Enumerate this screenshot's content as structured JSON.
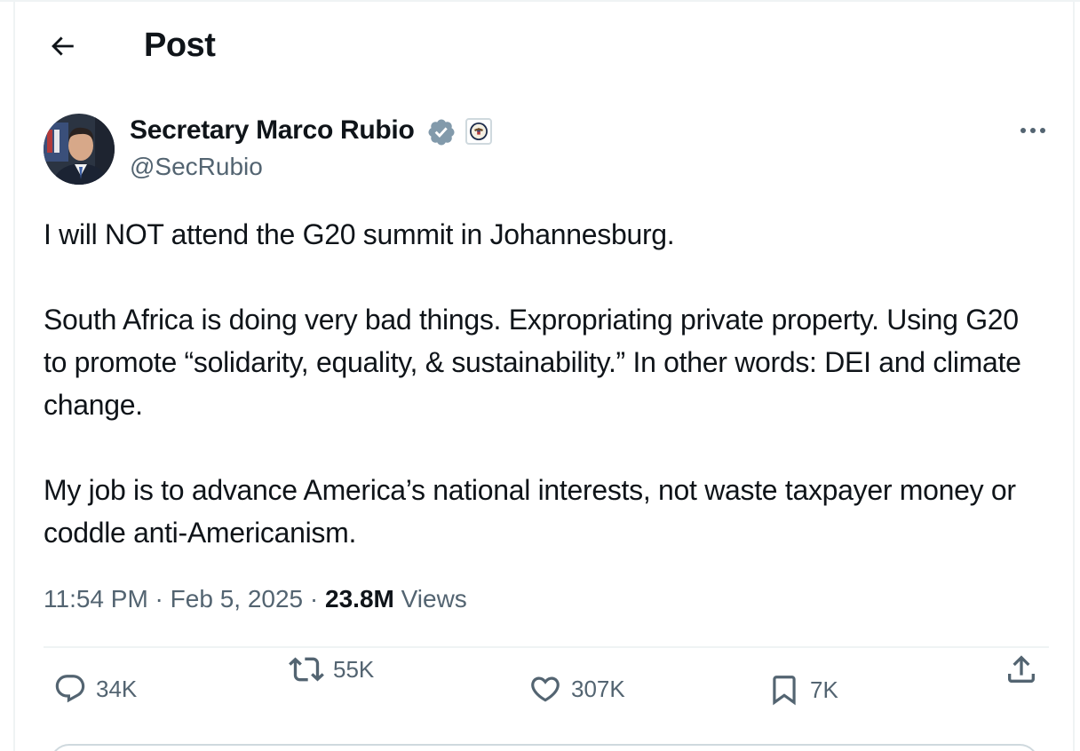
{
  "header": {
    "title": "Post",
    "back_icon": "arrow-left-icon"
  },
  "author": {
    "name": "Secretary Marco Rubio",
    "handle": "@SecRubio",
    "verified_color": "#829aab",
    "affiliate_badge": "state-department-seal-icon"
  },
  "post": {
    "paragraphs": [
      "I will NOT attend the G20 summit in Johannesburg.",
      "South Africa is doing very bad things. Expropriating private property. Using G20 to promote “solidarity, equality, & sustainability.” In other words: DEI and climate change.",
      "My job is to advance America’s national interests, not waste taxpayer money or coddle anti-Americanism."
    ]
  },
  "meta": {
    "time": "11:54 PM",
    "separator": " · ",
    "date": "Feb 5, 2025",
    "views_count": "23.8M",
    "views_label": "Views"
  },
  "actions": {
    "replies": "34K",
    "reposts": "55K",
    "likes": "307K",
    "bookmarks": "7K"
  },
  "colors": {
    "text": "#0f1419",
    "secondary": "#536471",
    "border": "#eff3f4"
  }
}
